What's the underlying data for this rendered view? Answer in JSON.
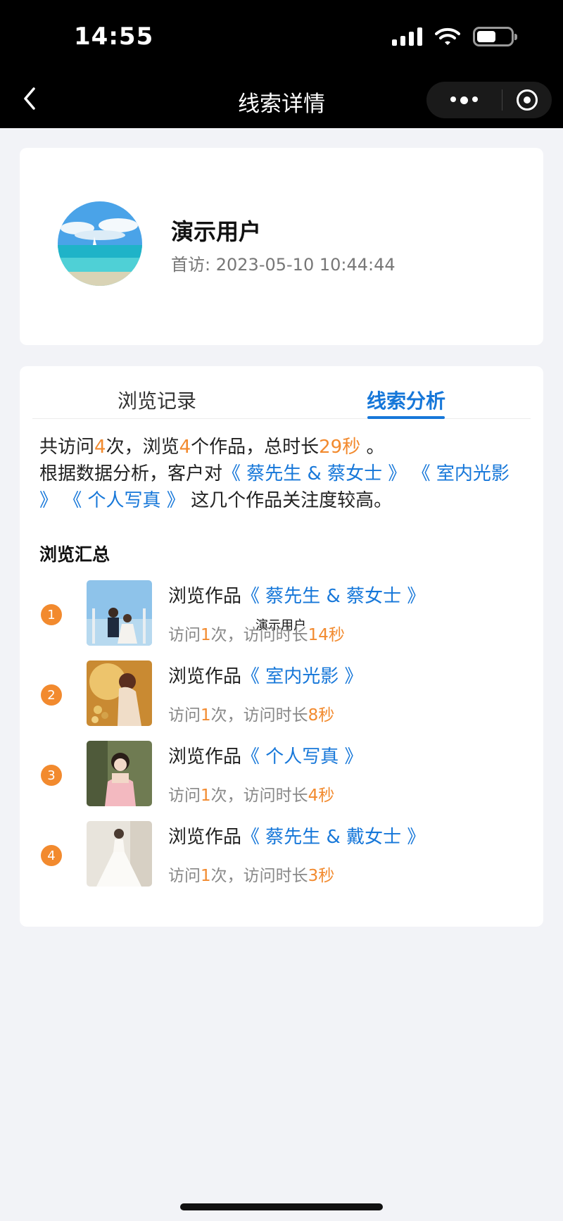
{
  "status": {
    "time": "14:55"
  },
  "nav": {
    "title": "线索详情"
  },
  "profile": {
    "name": "演示用户",
    "first_visit_label": "首访:",
    "first_visit_value": "2023-05-10 10:44:44"
  },
  "tabs": [
    {
      "label": "浏览记录",
      "active": false
    },
    {
      "label": "线索分析",
      "active": true
    }
  ],
  "summary": {
    "p1": "共访问",
    "visits": "4",
    "p2": "次，浏览",
    "works": "4",
    "p3": "个作品，总时长",
    "duration": "29秒",
    "p4": " 。",
    "p5": "根据数据分析，客户对",
    "work1": "《 蔡先生 & 蔡女士 》",
    "work2": "《 室内光影 》",
    "work3": "《 个人写真 》",
    "p6": " 这几个作品关注度较高。"
  },
  "section_title": "浏览汇总",
  "floating_label": "演示用户",
  "items": [
    {
      "rank": "1",
      "prefix": "浏览作品",
      "work": "《 蔡先生 & 蔡女士 》",
      "meta1": "访问",
      "count": "1",
      "meta2": "次，访问时长",
      "duration": "14秒"
    },
    {
      "rank": "2",
      "prefix": "浏览作品",
      "work": "《 室内光影 》",
      "meta1": "访问",
      "count": "1",
      "meta2": "次，访问时长",
      "duration": "8秒"
    },
    {
      "rank": "3",
      "prefix": "浏览作品",
      "work": "《 个人写真 》",
      "meta1": "访问",
      "count": "1",
      "meta2": "次，访问时长",
      "duration": "4秒"
    },
    {
      "rank": "4",
      "prefix": "浏览作品",
      "work": "《 蔡先生 & 戴女士 》",
      "meta1": "访问",
      "count": "1",
      "meta2": "次，访问时长",
      "duration": "3秒"
    }
  ],
  "colors": {
    "accent_blue": "#1677d9",
    "accent_orange": "#f28a2e",
    "background": "#f2f3f7"
  }
}
